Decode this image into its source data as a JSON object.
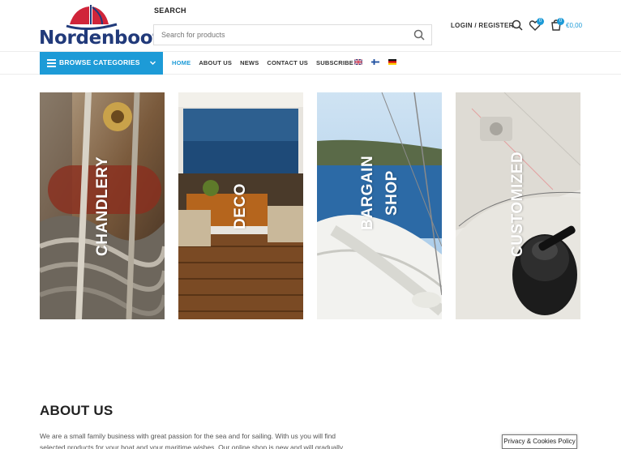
{
  "brand": {
    "name": "Nordenboot"
  },
  "search": {
    "label": "SEARCH",
    "placeholder": "Search for products"
  },
  "header": {
    "login_label": "LOGIN / REGISTER",
    "wishlist_count": "0",
    "cart_count": "0",
    "cart_total": "€0,00"
  },
  "nav": {
    "browse_label": "BROWSE CATEGORIES",
    "items": [
      {
        "label": "HOME"
      },
      {
        "label": "ABOUT US"
      },
      {
        "label": "NEWS"
      },
      {
        "label": "CONTACT US"
      },
      {
        "label": "SUBSCRIBE"
      }
    ],
    "languages": [
      "english-flag-icon",
      "finnish-flag-icon",
      "german-flag-icon"
    ]
  },
  "categories": [
    {
      "label": "CHANDLERY"
    },
    {
      "label_line1": "DECO"
    },
    {
      "label_line1": "BARGAIN",
      "label_line2": "SHOP"
    },
    {
      "label": "CUSTOMIZED"
    }
  ],
  "about": {
    "title": "ABOUT US",
    "text": "We are a small family business with great passion for the sea and for sailing. With us you will find selected products for your boat and your maritime wishes. Our online shop is new and will gradually"
  },
  "cookie": {
    "label": "Privacy & Cookies Policy"
  },
  "colors": {
    "accent": "#1d9bd7",
    "brand_blue": "#213a7a",
    "brand_red": "#d0253a"
  }
}
